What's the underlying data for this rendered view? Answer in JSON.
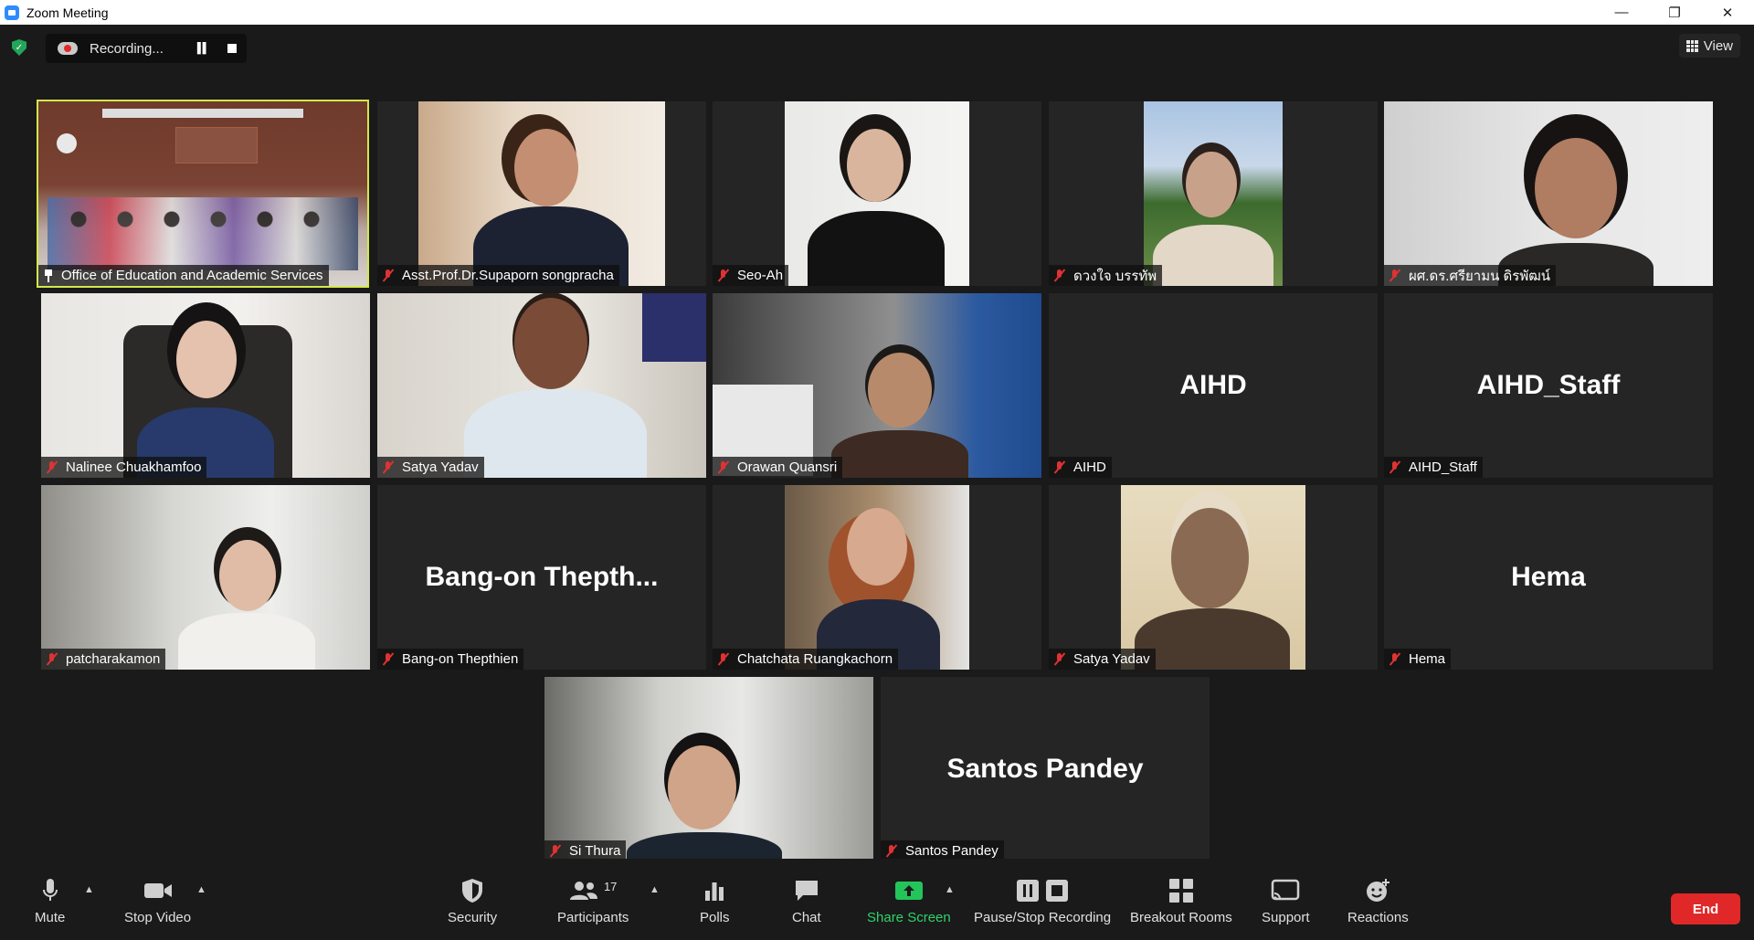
{
  "window": {
    "title": "Zoom Meeting",
    "minimize": "—",
    "restore": "❐",
    "close": "✕"
  },
  "recording": {
    "label": "Recording..."
  },
  "view": {
    "label": "View"
  },
  "participants": [
    {
      "name": "Office of Education and Academic Services",
      "has_video": true
    },
    {
      "name": "Asst.Prof.Dr.Supaporn songpracha",
      "has_video": true
    },
    {
      "name": "Seo-Ah",
      "has_video": true
    },
    {
      "name": "ดวงใจ บรรทัพ",
      "has_video": true
    },
    {
      "name": "ผศ.ดร.ศรียามน ดิรพัฒน์",
      "has_video": true
    },
    {
      "name": "Nalinee Chuakhamfoo",
      "has_video": true
    },
    {
      "name": "Satya Yadav",
      "has_video": true
    },
    {
      "name": "Orawan Quansri",
      "has_video": true
    },
    {
      "name": "AIHD",
      "display": "AIHD",
      "has_video": false
    },
    {
      "name": "AIHD_Staff",
      "display": "AIHD_Staff",
      "has_video": false
    },
    {
      "name": "patcharakamon",
      "has_video": true
    },
    {
      "name": "Bang-on Thepthien",
      "display": "Bang-on  Thepth...",
      "has_video": false
    },
    {
      "name": "Chatchata Ruangkachorn",
      "has_video": true
    },
    {
      "name": "Satya Yadav",
      "has_video": true
    },
    {
      "name": "Hema",
      "display": "Hema",
      "has_video": false
    },
    {
      "name": "Si Thura",
      "has_video": true
    },
    {
      "name": "Santos Pandey",
      "display": "Santos Pandey",
      "has_video": false
    }
  ],
  "toolbar": {
    "mute": "Mute",
    "stop_video": "Stop Video",
    "security": "Security",
    "participants": "Participants",
    "participants_count": "17",
    "polls": "Polls",
    "chat": "Chat",
    "share_screen": "Share Screen",
    "pause_stop_recording": "Pause/Stop Recording",
    "breakout_rooms": "Breakout Rooms",
    "support": "Support",
    "reactions": "Reactions",
    "end": "End"
  },
  "colors": {
    "active_speaker": "#d4e84a",
    "share_green": "#23c55a",
    "end_red": "#e02828",
    "muted_red": "#e03232"
  }
}
